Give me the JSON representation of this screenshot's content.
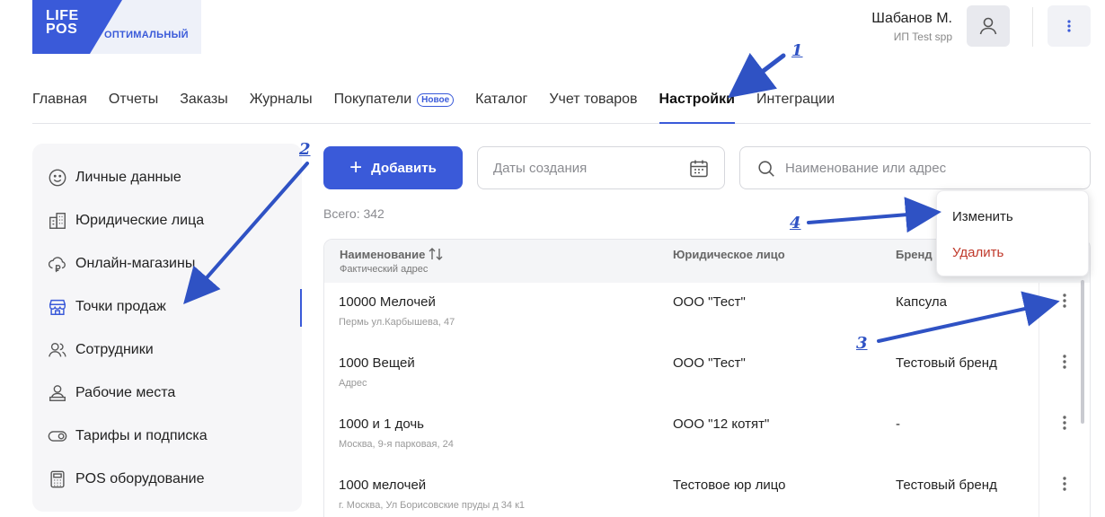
{
  "header": {
    "logo_line1": "LIFE",
    "logo_line2": "POS",
    "plan": "ОПТИМАЛЬНЫЙ",
    "user_name": "Шабанов М.",
    "user_org": "ИП Test spp",
    "colors": {
      "brand": "#3a5ad9",
      "danger": "#c0392b"
    }
  },
  "nav": {
    "items": [
      {
        "label": "Главная"
      },
      {
        "label": "Отчеты"
      },
      {
        "label": "Заказы"
      },
      {
        "label": "Журналы"
      },
      {
        "label": "Покупатели",
        "badge": "Новое"
      },
      {
        "label": "Каталог"
      },
      {
        "label": "Учет товаров"
      },
      {
        "label": "Настройки",
        "active": true
      },
      {
        "label": "Интеграции"
      }
    ]
  },
  "sidebar": {
    "items": [
      {
        "label": "Личные данные",
        "icon": "smile-icon"
      },
      {
        "label": "Юридические лица",
        "icon": "building-icon"
      },
      {
        "label": "Онлайн-магазины",
        "icon": "cloud-ruble-icon"
      },
      {
        "label": "Точки продаж",
        "icon": "store-icon",
        "active": true
      },
      {
        "label": "Сотрудники",
        "icon": "users-icon"
      },
      {
        "label": "Рабочие места",
        "icon": "workplace-icon"
      },
      {
        "label": "Тарифы и подписка",
        "icon": "toggle-icon"
      },
      {
        "label": "POS оборудование",
        "icon": "calculator-icon"
      }
    ]
  },
  "toolbar": {
    "add_label": "Добавить",
    "date_placeholder": "Даты создания",
    "search_placeholder": "Наименование или адрес",
    "total": "Всего: 342"
  },
  "table": {
    "col_name": "Наименование",
    "col_name_sub": "Фактический адрес",
    "col_legal": "Юридическое лицо",
    "col_brand": "Бренд",
    "rows": [
      {
        "name": "10000 Мелочей",
        "address": "Пермь ул.Карбышева, 47",
        "legal": "ООО \"Тест\"",
        "brand": "Капсула"
      },
      {
        "name": "1000 Вещей",
        "address": "Адрес",
        "legal": "ООО \"Тест\"",
        "brand": "Тестовый бренд"
      },
      {
        "name": "1000 и 1 дочь",
        "address": "Москва, 9-я парковая, 24",
        "legal": "ООО \"12 котят\"",
        "brand": "-"
      },
      {
        "name": "1000 мелочей",
        "address": "г. Москва, Ул Борисовские пруды д 34 к1",
        "legal": "Тестовое юр лицо",
        "brand": "Тестовый бренд"
      }
    ]
  },
  "dropdown": {
    "edit_label": "Изменить",
    "delete_label": "Удалить"
  },
  "annotations": [
    "1",
    "2",
    "3",
    "4"
  ]
}
